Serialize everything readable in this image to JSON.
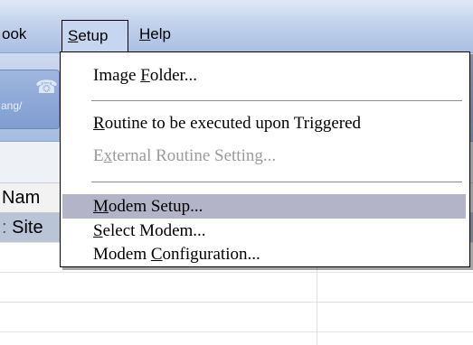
{
  "menubar": {
    "items": [
      {
        "pre": "",
        "acc": "",
        "post": "ook"
      },
      {
        "pre": "",
        "acc": "S",
        "post": "etup"
      },
      {
        "pre": "",
        "acc": "H",
        "post": "elp"
      }
    ]
  },
  "toolbar": {
    "button_label": "ang/"
  },
  "grid": {
    "header": "Nam",
    "rows": [
      "Site"
    ]
  },
  "setup_menu": {
    "items": [
      {
        "pre": "Image ",
        "acc": "F",
        "post": "older..."
      },
      {
        "pre": "",
        "acc": "R",
        "post": "outine to be executed upon Triggered"
      },
      {
        "pre": "E",
        "acc": "x",
        "post": "ternal Routine Setting..."
      },
      {
        "pre": "",
        "acc": "M",
        "post": "odem Setup..."
      },
      {
        "pre": "",
        "acc": "S",
        "post": "elect Modem..."
      },
      {
        "pre": "Modem ",
        "acc": "C",
        "post": "onfiguration..."
      }
    ]
  }
}
